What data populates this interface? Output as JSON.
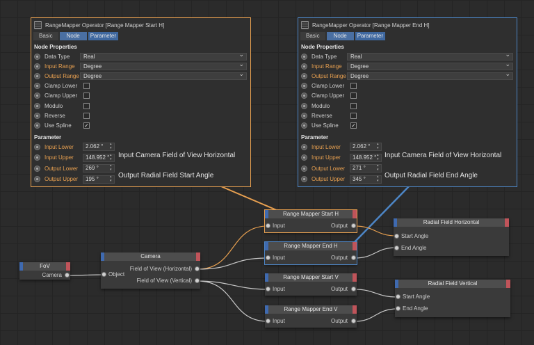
{
  "panel_left": {
    "title": "RangeMapper Operator [Range Mapper Start H]",
    "tabs": [
      "Basic",
      "Node",
      "Parameter"
    ],
    "section_node": "Node Properties",
    "data_type_label": "Data Type",
    "data_type": "Real",
    "input_range_label": "Input Range",
    "input_range": "Degree",
    "output_range_label": "Output Range",
    "output_range": "Degree",
    "clamp_lower": "Clamp Lower",
    "clamp_upper": "Clamp Upper",
    "modulo": "Modulo",
    "reverse": "Reverse",
    "use_spline": "Use Spline",
    "section_param": "Parameter",
    "input_lower_label": "Input Lower",
    "input_lower": "2.062 °",
    "input_upper_label": "Input Upper",
    "input_upper": "148.952 °",
    "output_lower_label": "Output Lower",
    "output_lower": "269 °",
    "output_upper_label": "Output Upper",
    "output_upper": "195 °",
    "note1": "Input Camera Field of View Horizontal",
    "note2": "Output Radial Field Start Angle"
  },
  "panel_right": {
    "title": "RangeMapper Operator [Range Mapper End H]",
    "tabs": [
      "Basic",
      "Node",
      "Parameter"
    ],
    "section_node": "Node Properties",
    "data_type_label": "Data Type",
    "data_type": "Real",
    "input_range_label": "Input Range",
    "input_range": "Degree",
    "output_range_label": "Output Range",
    "output_range": "Degree",
    "clamp_lower": "Clamp Lower",
    "clamp_upper": "Clamp Upper",
    "modulo": "Modulo",
    "reverse": "Reverse",
    "use_spline": "Use Spline",
    "section_param": "Parameter",
    "input_lower_label": "Input Lower",
    "input_lower": "2.062 °",
    "input_upper_label": "Input Upper",
    "input_upper": "148.952 °",
    "output_lower_label": "Output Lower",
    "output_lower": "271 °",
    "output_upper_label": "Output Upper",
    "output_upper": "345 °",
    "note1": "Input Camera Field of View Horizontal",
    "note2": "Output Radial Field End Angle"
  },
  "nodes": {
    "fov": {
      "title": "FoV",
      "out": "Camera"
    },
    "camera": {
      "title": "Camera",
      "in": "Object",
      "out1": "Field of View (Horizontal)",
      "out2": "Field of View (Vertical)"
    },
    "rm_start_h": {
      "title": "Range Mapper Start H",
      "in": "Input",
      "out": "Output"
    },
    "rm_end_h": {
      "title": "Range Mapper End H",
      "in": "Input",
      "out": "Output"
    },
    "rm_start_v": {
      "title": "Range Mapper Start V",
      "in": "Input",
      "out": "Output"
    },
    "rm_end_v": {
      "title": "Range Mapper End V",
      "in": "Input",
      "out": "Output"
    },
    "rf_h": {
      "title": "Radial Field Horizontal",
      "in1": "Start Angle",
      "in2": "End Angle"
    },
    "rf_v": {
      "title": "Radial Field Vertical",
      "in1": "Start Angle",
      "in2": "End Angle"
    }
  },
  "colors": {
    "accent_orange": "#e8a050",
    "accent_blue": "#4d86c6",
    "wire": "#c8c8c8",
    "port_blue": "#3f6ab0",
    "port_red": "#c0545a"
  }
}
